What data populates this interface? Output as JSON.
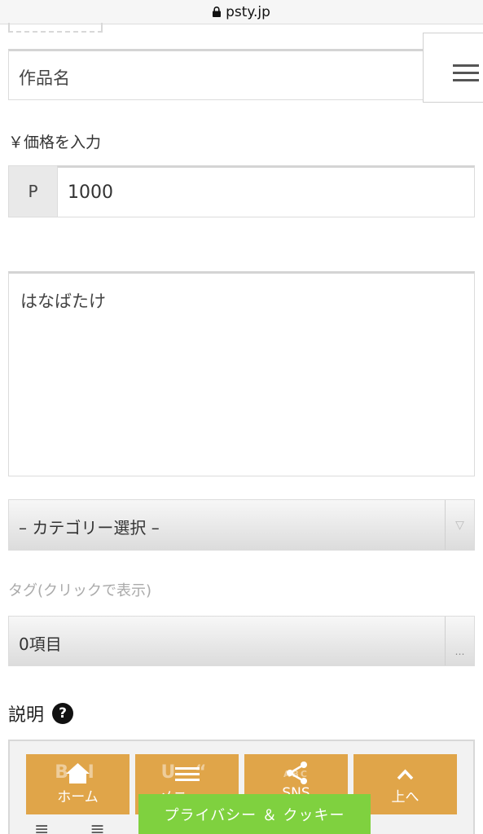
{
  "browser": {
    "url": "psty.jp"
  },
  "form": {
    "title_placeholder": "作品名",
    "price_label": "￥価格を入力",
    "price_prefix": "P",
    "price_value": "1000",
    "description_text": "はなばたけ",
    "category_select": "– カテゴリー選択 –",
    "tag_label": "タグ(クリックで表示)",
    "tag_value": "0項目",
    "explain_label": "説明"
  },
  "nav": {
    "home_label": "ホーム",
    "menu_label": "メニュー",
    "sns_label": "SNS",
    "top_label": "上へ"
  },
  "privacy": {
    "label": "プライバシー ＆ クッキー"
  },
  "colors": {
    "nav_bg": "#e0a549",
    "privacy_bg": "#7fd13f"
  }
}
